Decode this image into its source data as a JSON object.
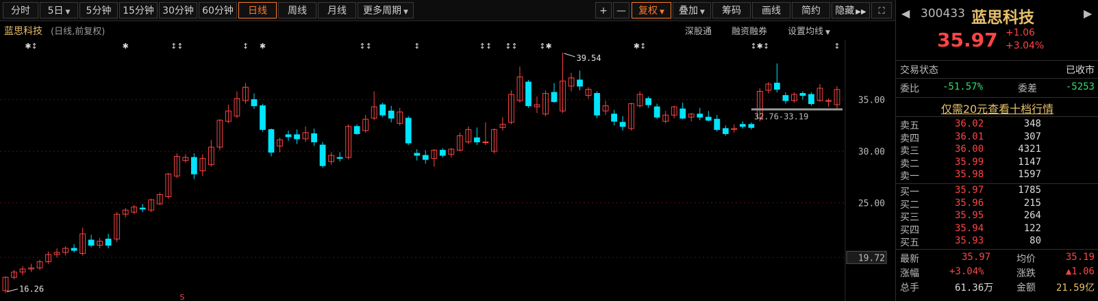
{
  "toolbar": {
    "tabs": [
      "分时",
      "5日",
      "5分钟",
      "15分钟",
      "30分钟",
      "60分钟",
      "日线",
      "周线",
      "月线",
      "更多周期"
    ],
    "active_tab": "日线",
    "zoom_in": "+",
    "zoom_out": "—",
    "restore": "复权",
    "overlay": "叠加",
    "chips": "筹码",
    "draw": "画线",
    "simple": "简约",
    "hide": "隐藏"
  },
  "header": {
    "stock_name": "蓝思科技",
    "subtitle": "(日线,前复权)",
    "link_shgt": "深股通",
    "link_margin": "融资融券",
    "link_ma": "设置均线"
  },
  "colors": {
    "up": "#ff4545",
    "down": "#00e5ff",
    "grid": "#5a1414",
    "accent": "#ff7a2a",
    "name": "#e8c06a"
  },
  "chart_data": {
    "type": "candlestick",
    "ylim": [
      15.5,
      40.8
    ],
    "yticks": [
      "35.00",
      "30.00",
      "25.00",
      "19.72"
    ],
    "ytick_values": [
      35,
      30,
      25,
      19.72
    ],
    "max_label": "39.54",
    "max_value": 39.54,
    "min_label": "16.26",
    "min_value": 16.26,
    "range_label": "32.76-33.19",
    "event_marks": [
      "✱↕",
      "✱",
      "↕↕",
      "↕",
      "✱",
      "↕↕",
      "↕",
      "↕↕",
      "↕↕",
      "↕✱",
      "✱↕",
      "↕✱↕",
      "↕"
    ],
    "event_indexes": [
      [
        3,
        "✱↕"
      ],
      [
        14,
        "✱"
      ],
      [
        20,
        "↕↕"
      ],
      [
        28,
        "↕"
      ],
      [
        30,
        "✱"
      ],
      [
        42,
        "↕↕"
      ],
      [
        48,
        "↕"
      ],
      [
        56,
        "↕↕"
      ],
      [
        59,
        "↕↕"
      ],
      [
        63,
        "↕✱"
      ],
      [
        74,
        "✱↕"
      ],
      [
        88,
        "↕✱↕"
      ],
      [
        97,
        "↕"
      ]
    ],
    "candles": [
      {
        "o": 16.5,
        "h": 17.9,
        "l": 16.26,
        "c": 17.8
      },
      {
        "o": 17.8,
        "h": 18.5,
        "l": 17.6,
        "c": 18.3
      },
      {
        "o": 18.3,
        "h": 18.9,
        "l": 18.0,
        "c": 18.6
      },
      {
        "o": 18.6,
        "h": 19.1,
        "l": 18.3,
        "c": 18.7
      },
      {
        "o": 18.7,
        "h": 19.5,
        "l": 18.5,
        "c": 19.3
      },
      {
        "o": 19.3,
        "h": 20.3,
        "l": 19.1,
        "c": 20.0
      },
      {
        "o": 20.0,
        "h": 20.6,
        "l": 19.7,
        "c": 20.2
      },
      {
        "o": 20.2,
        "h": 20.8,
        "l": 19.9,
        "c": 20.6
      },
      {
        "o": 20.6,
        "h": 21.0,
        "l": 20.2,
        "c": 20.4
      },
      {
        "o": 20.1,
        "h": 22.6,
        "l": 19.9,
        "c": 22.0
      },
      {
        "o": 21.4,
        "h": 21.9,
        "l": 20.7,
        "c": 20.9
      },
      {
        "o": 20.9,
        "h": 21.6,
        "l": 20.6,
        "c": 21.3
      },
      {
        "o": 21.5,
        "h": 22.0,
        "l": 20.6,
        "c": 20.9
      },
      {
        "o": 21.5,
        "h": 24.1,
        "l": 21.2,
        "c": 23.9
      },
      {
        "o": 23.9,
        "h": 24.5,
        "l": 23.6,
        "c": 24.3
      },
      {
        "o": 24.1,
        "h": 24.8,
        "l": 23.9,
        "c": 24.6
      },
      {
        "o": 24.5,
        "h": 24.9,
        "l": 24.1,
        "c": 24.4
      },
      {
        "o": 24.3,
        "h": 25.4,
        "l": 24.1,
        "c": 25.3
      },
      {
        "o": 24.9,
        "h": 26.0,
        "l": 24.8,
        "c": 25.8
      },
      {
        "o": 25.6,
        "h": 27.9,
        "l": 25.4,
        "c": 27.8
      },
      {
        "o": 27.6,
        "h": 29.8,
        "l": 27.4,
        "c": 29.5
      },
      {
        "o": 29.1,
        "h": 29.7,
        "l": 28.9,
        "c": 29.4
      },
      {
        "o": 29.4,
        "h": 29.8,
        "l": 27.3,
        "c": 27.8
      },
      {
        "o": 28.1,
        "h": 29.7,
        "l": 27.6,
        "c": 29.3
      },
      {
        "o": 28.7,
        "h": 31.1,
        "l": 28.5,
        "c": 30.4
      },
      {
        "o": 30.4,
        "h": 33.1,
        "l": 30.1,
        "c": 33.0
      },
      {
        "o": 32.9,
        "h": 34.5,
        "l": 32.7,
        "c": 33.9
      },
      {
        "o": 33.4,
        "h": 35.8,
        "l": 33.2,
        "c": 35.1
      },
      {
        "o": 34.9,
        "h": 36.6,
        "l": 34.6,
        "c": 36.2
      },
      {
        "o": 35.0,
        "h": 35.6,
        "l": 34.1,
        "c": 34.4
      },
      {
        "o": 34.4,
        "h": 34.6,
        "l": 31.9,
        "c": 32.1
      },
      {
        "o": 32.1,
        "h": 32.2,
        "l": 29.5,
        "c": 29.9
      },
      {
        "o": 30.5,
        "h": 31.3,
        "l": 29.9,
        "c": 31.1
      },
      {
        "o": 31.6,
        "h": 32.0,
        "l": 31.0,
        "c": 31.4
      },
      {
        "o": 31.6,
        "h": 32.1,
        "l": 30.7,
        "c": 31.2
      },
      {
        "o": 31.2,
        "h": 32.4,
        "l": 30.9,
        "c": 31.8
      },
      {
        "o": 31.7,
        "h": 32.2,
        "l": 30.5,
        "c": 30.9
      },
      {
        "o": 30.6,
        "h": 30.9,
        "l": 28.4,
        "c": 28.6
      },
      {
        "o": 29.0,
        "h": 29.9,
        "l": 28.7,
        "c": 29.6
      },
      {
        "o": 29.4,
        "h": 29.9,
        "l": 29.0,
        "c": 29.3
      },
      {
        "o": 29.4,
        "h": 32.6,
        "l": 29.2,
        "c": 32.4
      },
      {
        "o": 32.4,
        "h": 32.6,
        "l": 31.6,
        "c": 31.7
      },
      {
        "o": 32.0,
        "h": 33.5,
        "l": 31.8,
        "c": 33.1
      },
      {
        "o": 33.2,
        "h": 35.8,
        "l": 33.0,
        "c": 34.3
      },
      {
        "o": 34.5,
        "h": 34.7,
        "l": 33.3,
        "c": 33.5
      },
      {
        "o": 33.9,
        "h": 34.4,
        "l": 32.8,
        "c": 33.2
      },
      {
        "o": 32.7,
        "h": 34.2,
        "l": 32.5,
        "c": 33.8
      },
      {
        "o": 33.2,
        "h": 33.4,
        "l": 30.6,
        "c": 30.8
      },
      {
        "o": 29.8,
        "h": 30.2,
        "l": 29.1,
        "c": 29.6
      },
      {
        "o": 29.6,
        "h": 30.1,
        "l": 28.8,
        "c": 29.2
      },
      {
        "o": 29.3,
        "h": 30.2,
        "l": 28.5,
        "c": 30.1
      },
      {
        "o": 30.1,
        "h": 30.3,
        "l": 29.4,
        "c": 29.6
      },
      {
        "o": 29.7,
        "h": 30.3,
        "l": 29.4,
        "c": 30.2
      },
      {
        "o": 30.1,
        "h": 31.8,
        "l": 30.0,
        "c": 31.5
      },
      {
        "o": 30.9,
        "h": 32.4,
        "l": 30.7,
        "c": 32.1
      },
      {
        "o": 31.3,
        "h": 32.3,
        "l": 30.6,
        "c": 30.9
      },
      {
        "o": 30.9,
        "h": 32.8,
        "l": 30.6,
        "c": 30.9
      },
      {
        "o": 30.0,
        "h": 32.2,
        "l": 29.8,
        "c": 32.1
      },
      {
        "o": 32.3,
        "h": 33.3,
        "l": 32.0,
        "c": 32.6
      },
      {
        "o": 32.8,
        "h": 35.9,
        "l": 32.6,
        "c": 35.5
      },
      {
        "o": 34.9,
        "h": 38.2,
        "l": 34.7,
        "c": 37.2
      },
      {
        "o": 36.7,
        "h": 36.9,
        "l": 34.2,
        "c": 34.4
      },
      {
        "o": 34.3,
        "h": 35.3,
        "l": 33.7,
        "c": 34.5
      },
      {
        "o": 33.6,
        "h": 35.9,
        "l": 33.4,
        "c": 35.6
      },
      {
        "o": 35.7,
        "h": 36.6,
        "l": 34.7,
        "c": 34.8
      },
      {
        "o": 33.9,
        "h": 39.54,
        "l": 33.7,
        "c": 36.8
      },
      {
        "o": 36.3,
        "h": 37.6,
        "l": 35.8,
        "c": 37.1
      },
      {
        "o": 36.9,
        "h": 37.8,
        "l": 35.9,
        "c": 36.3
      },
      {
        "o": 35.4,
        "h": 36.2,
        "l": 35.1,
        "c": 36.0
      },
      {
        "o": 35.6,
        "h": 35.8,
        "l": 33.2,
        "c": 33.5
      },
      {
        "o": 33.9,
        "h": 34.9,
        "l": 33.5,
        "c": 34.4
      },
      {
        "o": 33.6,
        "h": 34.0,
        "l": 32.5,
        "c": 32.9
      },
      {
        "o": 32.8,
        "h": 33.4,
        "l": 32.0,
        "c": 32.4
      },
      {
        "o": 32.2,
        "h": 34.7,
        "l": 32.0,
        "c": 34.6
      },
      {
        "o": 34.4,
        "h": 35.8,
        "l": 34.2,
        "c": 35.5
      },
      {
        "o": 35.1,
        "h": 35.3,
        "l": 34.2,
        "c": 34.5
      },
      {
        "o": 34.3,
        "h": 34.6,
        "l": 33.1,
        "c": 33.3
      },
      {
        "o": 32.9,
        "h": 33.9,
        "l": 32.7,
        "c": 33.5
      },
      {
        "o": 33.5,
        "h": 34.4,
        "l": 33.2,
        "c": 34.3
      },
      {
        "o": 34.1,
        "h": 34.7,
        "l": 33.1,
        "c": 33.2
      },
      {
        "o": 33.3,
        "h": 33.7,
        "l": 32.9,
        "c": 33.6
      },
      {
        "o": 33.6,
        "h": 34.2,
        "l": 33.0,
        "c": 33.3
      },
      {
        "o": 33.3,
        "h": 33.9,
        "l": 32.9,
        "c": 33.0
      },
      {
        "o": 33.1,
        "h": 33.5,
        "l": 31.9,
        "c": 32.1
      },
      {
        "o": 32.2,
        "h": 32.5,
        "l": 31.5,
        "c": 31.7
      },
      {
        "o": 32.1,
        "h": 32.6,
        "l": 31.8,
        "c": 32.2
      },
      {
        "o": 32.6,
        "h": 32.9,
        "l": 32.2,
        "c": 32.4
      },
      {
        "o": 32.6,
        "h": 32.8,
        "l": 32.1,
        "c": 32.3
      },
      {
        "o": 33.2,
        "h": 36.1,
        "l": 32.9,
        "c": 35.8
      },
      {
        "o": 35.9,
        "h": 36.7,
        "l": 35.6,
        "c": 36.5
      },
      {
        "o": 36.6,
        "h": 38.5,
        "l": 35.7,
        "c": 36.0
      },
      {
        "o": 35.4,
        "h": 35.7,
        "l": 34.6,
        "c": 34.9
      },
      {
        "o": 34.9,
        "h": 35.7,
        "l": 34.7,
        "c": 35.5
      },
      {
        "o": 35.6,
        "h": 35.8,
        "l": 35.0,
        "c": 35.4
      },
      {
        "o": 35.5,
        "h": 35.7,
        "l": 34.4,
        "c": 34.6
      },
      {
        "o": 34.9,
        "h": 36.5,
        "l": 34.8,
        "c": 36.1
      },
      {
        "o": 34.9,
        "h": 35.1,
        "l": 34.3,
        "c": 34.9
      },
      {
        "o": 34.5,
        "h": 36.3,
        "l": 34.0,
        "c": 35.97
      }
    ]
  },
  "quote": {
    "code": "300433",
    "name": "蓝思科技",
    "price": "35.97",
    "change": "+1.06",
    "change_pct": "+3.04%",
    "status_label": "交易状态",
    "status_value": "已收市",
    "ratio_label": "委比",
    "ratio_value": "-51.57%",
    "diff_label": "委差",
    "diff_value": "-5253",
    "promo": "仅需20元查看十档行情"
  },
  "asks": [
    {
      "label": "卖五",
      "price": "36.02",
      "vol": "348"
    },
    {
      "label": "卖四",
      "price": "36.01",
      "vol": "307"
    },
    {
      "label": "卖三",
      "price": "36.00",
      "vol": "4321"
    },
    {
      "label": "卖二",
      "price": "35.99",
      "vol": "1147"
    },
    {
      "label": "卖一",
      "price": "35.98",
      "vol": "1597"
    }
  ],
  "bids": [
    {
      "label": "买一",
      "price": "35.97",
      "vol": "1785"
    },
    {
      "label": "买二",
      "price": "35.96",
      "vol": "215"
    },
    {
      "label": "买三",
      "price": "35.95",
      "vol": "264"
    },
    {
      "label": "买四",
      "price": "35.94",
      "vol": "122"
    },
    {
      "label": "买五",
      "price": "35.93",
      "vol": "80"
    }
  ],
  "stats": {
    "latest_label": "最新",
    "latest_value": "35.97",
    "avg_label": "均价",
    "avg_value": "35.19",
    "chg_pct_label": "涨幅",
    "chg_pct_value": "+3.04%",
    "chg_label": "涨跌",
    "chg_value": "▲1.06",
    "vol_label": "总手",
    "vol_value": "61.36万",
    "amount_label": "金额",
    "amount_value": "21.59亿"
  }
}
